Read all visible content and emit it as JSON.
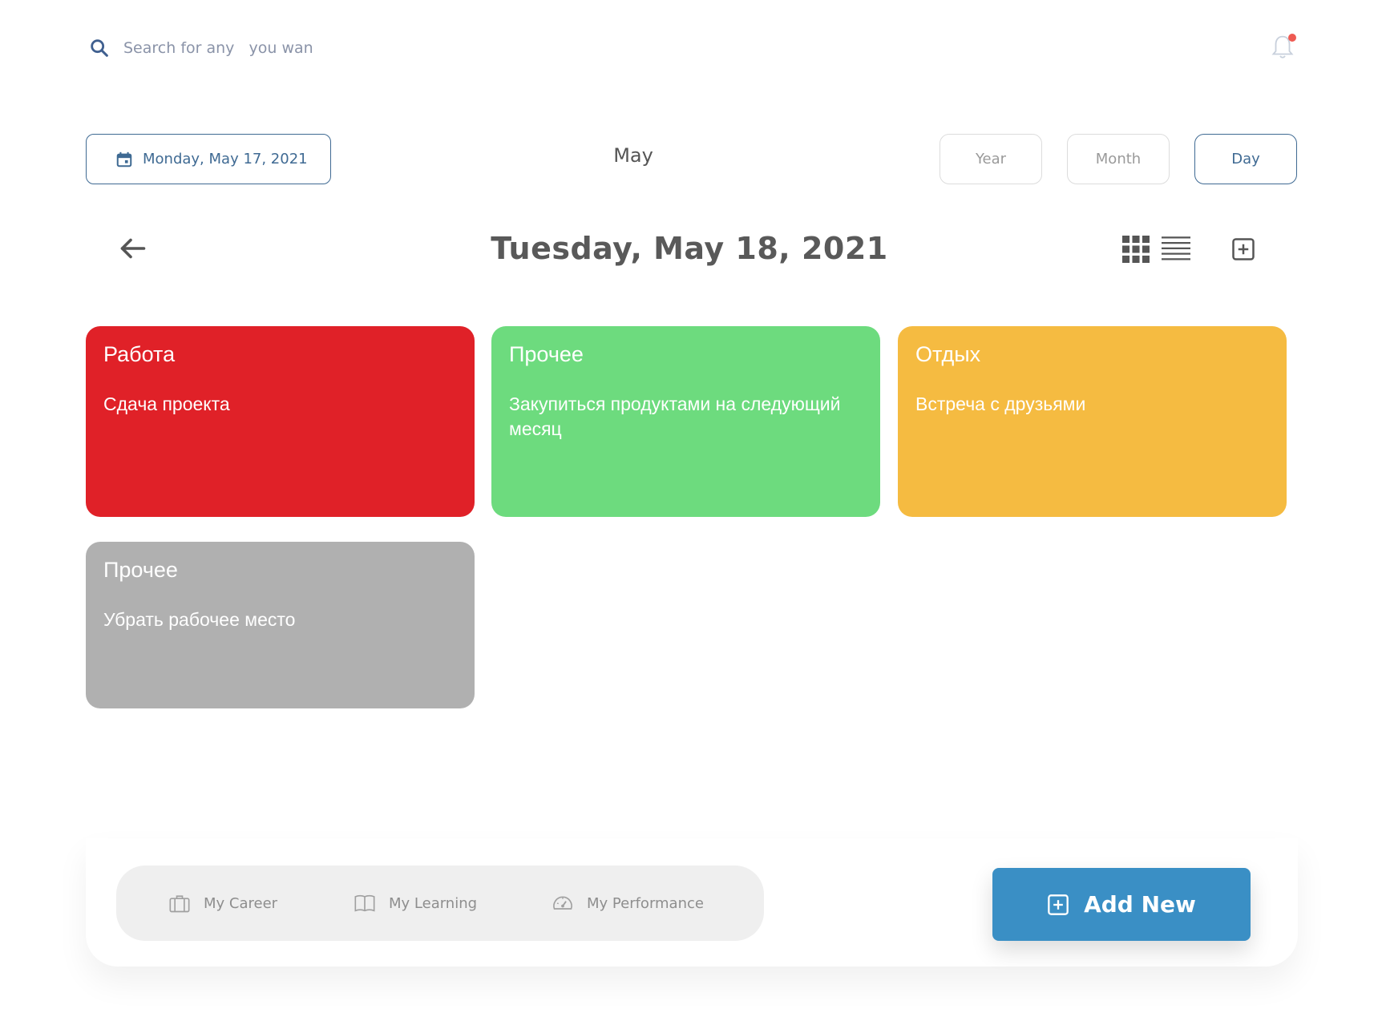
{
  "search": {
    "placeholder": "Search for any   you wan",
    "icon": "search-icon"
  },
  "notification": {
    "icon": "bell-icon",
    "has_unread": true,
    "dot_color": "#ee5a52"
  },
  "date_picker": {
    "label": "Monday, May 17, 2021",
    "icon": "calendar-icon"
  },
  "month_title": "May",
  "view_buttons": [
    {
      "label": "Year",
      "active": false
    },
    {
      "label": "Month",
      "active": false
    },
    {
      "label": "Day",
      "active": true
    }
  ],
  "day_header": {
    "title": "Tuesday, May 18, 2021",
    "back_icon": "arrow-left-icon"
  },
  "layout_icons": [
    "grid-view-icon",
    "list-view-icon",
    "add-square-icon"
  ],
  "cards": [
    {
      "category": "Работа",
      "description": "Сдача проекта",
      "color": "#e02128"
    },
    {
      "category": "Прочее",
      "description": "Закупиться продуктами на следующий месяц",
      "color": "#6ddb7e"
    },
    {
      "category": "Отдых",
      "description": "Встреча с друзьями",
      "color": "#f5bb41"
    },
    {
      "category": "Прочее",
      "description": "Убрать рабочее место",
      "color": "#b0b0b0"
    }
  ],
  "bottom_nav": {
    "tabs": [
      {
        "label": "My Career",
        "icon": "briefcase-icon"
      },
      {
        "label": "My Learning",
        "icon": "book-icon"
      },
      {
        "label": "My Performance",
        "icon": "speedometer-icon"
      }
    ],
    "add_new": {
      "label": "Add New",
      "icon": "add-square-icon",
      "color": "#3a8fc5"
    }
  }
}
